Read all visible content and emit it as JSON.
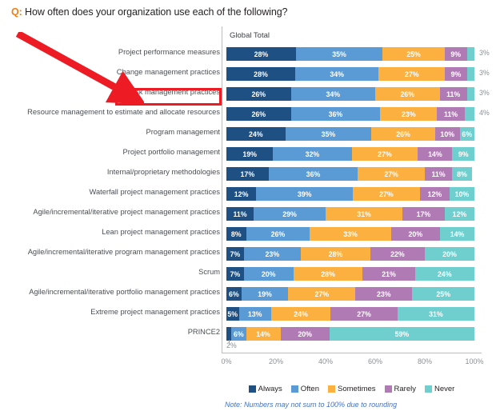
{
  "title": {
    "prefix": "Q:",
    "text": " How often does your organization use each of the following?"
  },
  "chart_header": "Global Total",
  "colors": {
    "always": "#1F5083",
    "often": "#5B9BD5",
    "sometimes": "#FBB040",
    "rarely": "#B07BB5",
    "never": "#6FCFCF",
    "outside_label": "#8b9095",
    "accent_orange": "#F07F13",
    "annotation_red": "#ED1C24",
    "note_blue": "#4472C4"
  },
  "note": "Note: Numbers may not sum to 100% due to rounding",
  "annotation": {
    "highlighted_category": "Risk management practices",
    "arrow": "red-arrow"
  },
  "chart_data": {
    "type": "bar",
    "orientation": "horizontal",
    "stacked": true,
    "title": "How often does your organization use each of the following?",
    "xlabel": "",
    "ylabel": "",
    "xlim": [
      0,
      100
    ],
    "grid": false,
    "legend_position": "bottom",
    "xticks": [
      "0%",
      "20%",
      "40%",
      "60%",
      "80%",
      "100%"
    ],
    "xtick_values": [
      0,
      20,
      40,
      60,
      80,
      100
    ],
    "legend": [
      "Always",
      "Often",
      "Sometimes",
      "Rarely",
      "Never"
    ],
    "categories": [
      "Project performance measures",
      "Change management practices",
      "Risk management practices",
      "Resource management to estimate and allocate resources",
      "Program management",
      "Project portfolio management",
      "Internal/proprietary methodologies",
      "Waterfall project management practices",
      "Agile/incremental/iterative project management practices",
      "Lean project management practices",
      "Agile/incremental/iterative program management practices",
      "Scrum",
      "Agile/incremental/iterative portfolio management practices",
      "Extreme project management practices",
      "PRINCE2"
    ],
    "series": [
      {
        "name": "Always",
        "values": [
          28,
          28,
          26,
          26,
          24,
          19,
          17,
          12,
          11,
          8,
          7,
          7,
          6,
          5,
          2
        ]
      },
      {
        "name": "Often",
        "values": [
          35,
          34,
          34,
          36,
          35,
          32,
          36,
          39,
          29,
          26,
          23,
          20,
          19,
          13,
          6
        ]
      },
      {
        "name": "Sometimes",
        "values": [
          25,
          27,
          26,
          23,
          26,
          27,
          27,
          27,
          31,
          33,
          28,
          28,
          27,
          24,
          14
        ]
      },
      {
        "name": "Rarely",
        "values": [
          9,
          9,
          11,
          11,
          10,
          14,
          11,
          12,
          17,
          20,
          22,
          21,
          23,
          27,
          20
        ]
      },
      {
        "name": "Never",
        "values": [
          3,
          3,
          3,
          4,
          6,
          9,
          8,
          10,
          12,
          14,
          20,
          24,
          25,
          31,
          59
        ]
      }
    ],
    "label_placement": {
      "never_outside_rows": [
        0,
        1,
        2,
        3
      ],
      "always_below_rows": [
        14
      ]
    }
  }
}
